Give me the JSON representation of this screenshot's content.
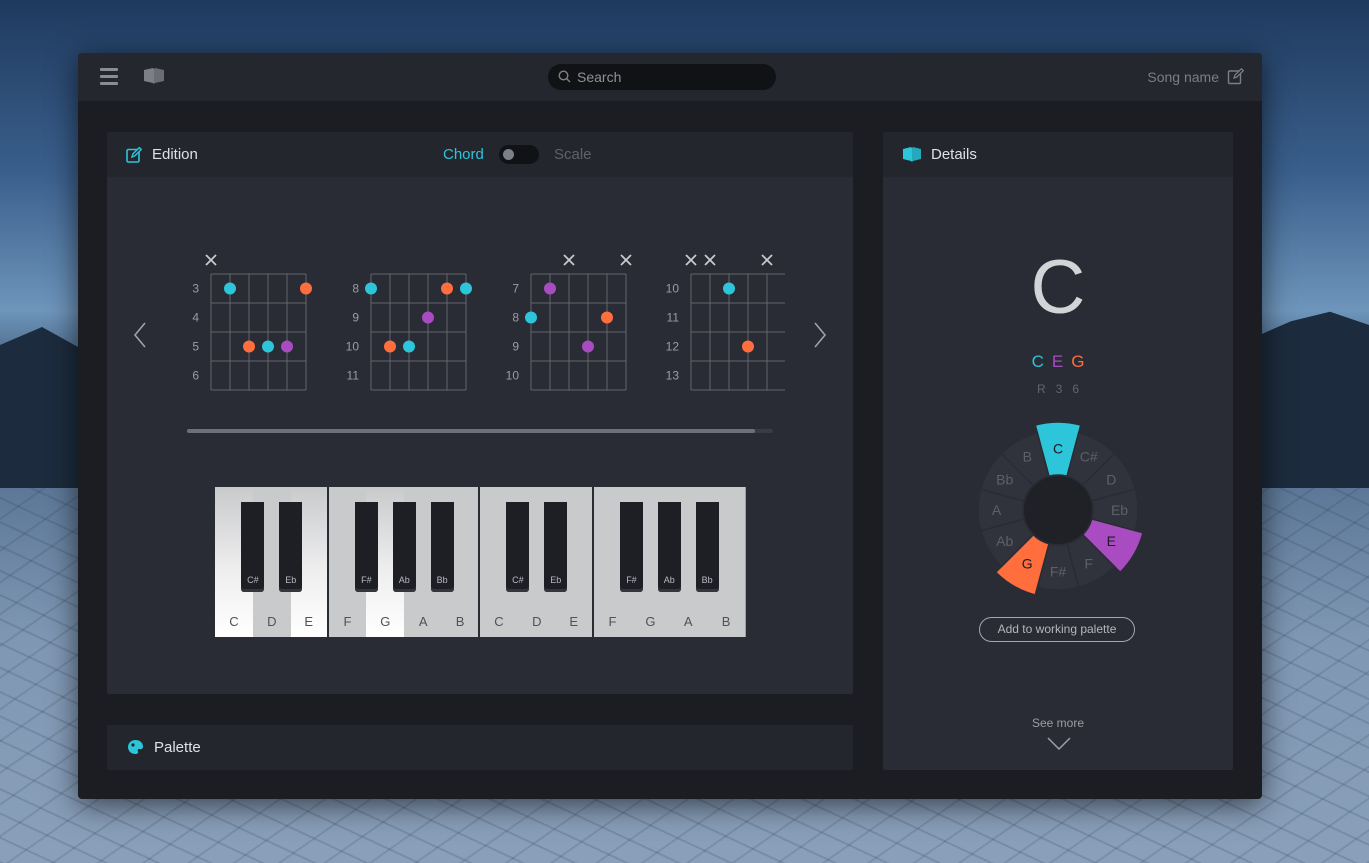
{
  "topbar": {
    "search_placeholder": "Search",
    "song_name": "Song name"
  },
  "edition": {
    "title": "Edition",
    "mode_chord": "Chord",
    "mode_scale": "Scale",
    "mode_selected": "Chord",
    "chord_diagrams": [
      {
        "frets": [
          "3",
          "4",
          "5",
          "6"
        ],
        "muted_strings": [
          1
        ],
        "dots": [
          {
            "string": 2,
            "fret_row": 1,
            "color": "cyan"
          },
          {
            "string": 6,
            "fret_row": 1,
            "color": "orange"
          },
          {
            "string": 3,
            "fret_row": 3,
            "color": "orange"
          },
          {
            "string": 4,
            "fret_row": 3,
            "color": "cyan"
          },
          {
            "string": 5,
            "fret_row": 3,
            "color": "purple"
          }
        ]
      },
      {
        "frets": [
          "8",
          "9",
          "10",
          "11"
        ],
        "muted_strings": [],
        "dots": [
          {
            "string": 1,
            "fret_row": 1,
            "color": "cyan"
          },
          {
            "string": 5,
            "fret_row": 1,
            "color": "orange"
          },
          {
            "string": 6,
            "fret_row": 1,
            "color": "cyan"
          },
          {
            "string": 4,
            "fret_row": 2,
            "color": "purple"
          },
          {
            "string": 2,
            "fret_row": 3,
            "color": "orange"
          },
          {
            "string": 3,
            "fret_row": 3,
            "color": "cyan"
          }
        ]
      },
      {
        "frets": [
          "7",
          "8",
          "9",
          "10"
        ],
        "muted_strings": [
          3,
          6
        ],
        "dots": [
          {
            "string": 2,
            "fret_row": 1,
            "color": "purple"
          },
          {
            "string": 1,
            "fret_row": 2,
            "color": "cyan"
          },
          {
            "string": 5,
            "fret_row": 2,
            "color": "orange"
          },
          {
            "string": 4,
            "fret_row": 3,
            "color": "purple"
          }
        ]
      },
      {
        "frets": [
          "10",
          "11",
          "12",
          "13"
        ],
        "muted_strings": [
          1,
          2,
          5
        ],
        "dots": [
          {
            "string": 3,
            "fret_row": 1,
            "color": "cyan"
          },
          {
            "string": 4,
            "fret_row": 3,
            "color": "orange"
          }
        ]
      }
    ],
    "piano": {
      "white_keys": [
        "C",
        "D",
        "E",
        "F",
        "G",
        "A",
        "B",
        "C",
        "D",
        "E",
        "F",
        "G",
        "A",
        "B"
      ],
      "black_keys": [
        "C#",
        "Eb",
        "F#",
        "Ab",
        "Bb",
        "C#",
        "Eb",
        "F#",
        "Ab",
        "Bb"
      ],
      "lit_white": [
        "C",
        "E",
        "G"
      ]
    }
  },
  "palette": {
    "title": "Palette"
  },
  "details": {
    "title": "Details",
    "chord_name": "C",
    "notes": [
      "C",
      "E",
      "G"
    ],
    "degrees": [
      "R",
      "3",
      "6"
    ],
    "wheel": {
      "labels": [
        "C",
        "C#",
        "D",
        "Eb",
        "E",
        "F",
        "F#",
        "G",
        "Ab",
        "A",
        "Bb",
        "B"
      ],
      "highlight": {
        "C": "cyan",
        "E": "purple",
        "G": "orange"
      }
    },
    "add_button": "Add to working palette",
    "see_more": "See more"
  },
  "colors": {
    "cyan": "#2cc5d9",
    "purple": "#a94bc1",
    "orange": "#ff6e3c",
    "background": "#1b1d22"
  }
}
